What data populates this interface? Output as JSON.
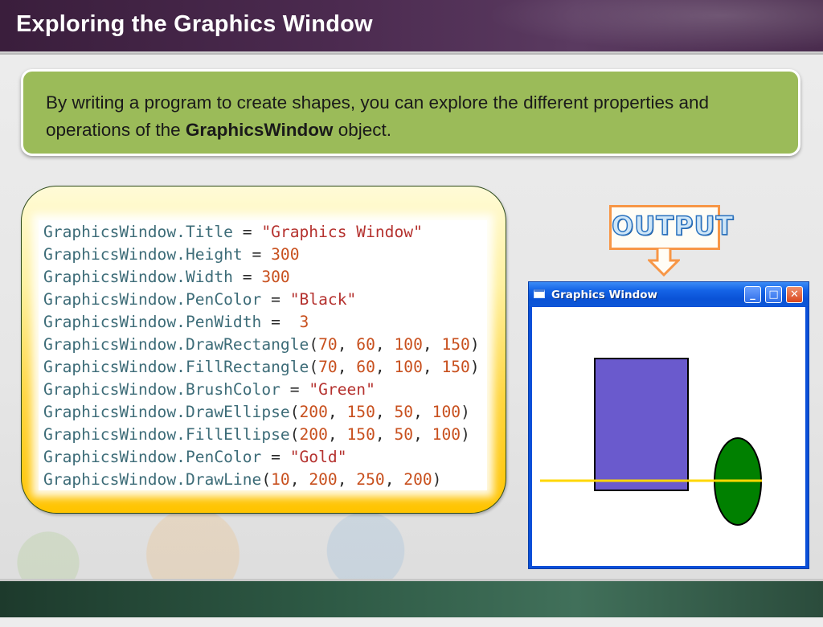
{
  "slide": {
    "title": "Exploring the Graphics Window",
    "intro": {
      "text_before": "By writing a program to create shapes, you can explore the different properties and operations of the ",
      "emphasis": "GraphicsWindow",
      "text_after": " object."
    }
  },
  "code": {
    "lines": [
      [
        {
          "t": "GraphicsWindow.Title ",
          "k": "id"
        },
        {
          "t": "= ",
          "k": "pun"
        },
        {
          "t": "\"Graphics Window\"",
          "k": "str"
        }
      ],
      [
        {
          "t": "GraphicsWindow.Height ",
          "k": "id"
        },
        {
          "t": "= ",
          "k": "pun"
        },
        {
          "t": "300",
          "k": "num"
        }
      ],
      [
        {
          "t": "GraphicsWindow.Width ",
          "k": "id"
        },
        {
          "t": "= ",
          "k": "pun"
        },
        {
          "t": "300",
          "k": "num"
        }
      ],
      [
        {
          "t": "GraphicsWindow.PenColor ",
          "k": "id"
        },
        {
          "t": "= ",
          "k": "pun"
        },
        {
          "t": "\"Black\"",
          "k": "str"
        }
      ],
      [
        {
          "t": "GraphicsWindow.PenWidth ",
          "k": "id"
        },
        {
          "t": "=  ",
          "k": "pun"
        },
        {
          "t": "3",
          "k": "num"
        }
      ],
      [
        {
          "t": "GraphicsWindow.DrawRectangle",
          "k": "id"
        },
        {
          "t": "(",
          "k": "pun"
        },
        {
          "t": "70",
          "k": "num"
        },
        {
          "t": ", ",
          "k": "pun"
        },
        {
          "t": "60",
          "k": "num"
        },
        {
          "t": ", ",
          "k": "pun"
        },
        {
          "t": "100",
          "k": "num"
        },
        {
          "t": ", ",
          "k": "pun"
        },
        {
          "t": "150",
          "k": "num"
        },
        {
          "t": ")",
          "k": "pun"
        }
      ],
      [
        {
          "t": "GraphicsWindow.FillRectangle",
          "k": "id"
        },
        {
          "t": "(",
          "k": "pun"
        },
        {
          "t": "70",
          "k": "num"
        },
        {
          "t": ", ",
          "k": "pun"
        },
        {
          "t": "60",
          "k": "num"
        },
        {
          "t": ", ",
          "k": "pun"
        },
        {
          "t": "100",
          "k": "num"
        },
        {
          "t": ", ",
          "k": "pun"
        },
        {
          "t": "150",
          "k": "num"
        },
        {
          "t": ")",
          "k": "pun"
        }
      ],
      [
        {
          "t": "GraphicsWindow.BrushColor ",
          "k": "id"
        },
        {
          "t": "= ",
          "k": "pun"
        },
        {
          "t": "\"Green\"",
          "k": "str"
        }
      ],
      [
        {
          "t": "GraphicsWindow.DrawEllipse",
          "k": "id"
        },
        {
          "t": "(",
          "k": "pun"
        },
        {
          "t": "200",
          "k": "num"
        },
        {
          "t": ", ",
          "k": "pun"
        },
        {
          "t": "150",
          "k": "num"
        },
        {
          "t": ", ",
          "k": "pun"
        },
        {
          "t": "50",
          "k": "num"
        },
        {
          "t": ", ",
          "k": "pun"
        },
        {
          "t": "100",
          "k": "num"
        },
        {
          "t": ")",
          "k": "pun"
        }
      ],
      [
        {
          "t": "GraphicsWindow.FillEllipse",
          "k": "id"
        },
        {
          "t": "(",
          "k": "pun"
        },
        {
          "t": "200",
          "k": "num"
        },
        {
          "t": ", ",
          "k": "pun"
        },
        {
          "t": "150",
          "k": "num"
        },
        {
          "t": ", ",
          "k": "pun"
        },
        {
          "t": "50",
          "k": "num"
        },
        {
          "t": ", ",
          "k": "pun"
        },
        {
          "t": "100",
          "k": "num"
        },
        {
          "t": ")",
          "k": "pun"
        }
      ],
      [
        {
          "t": "GraphicsWindow.PenColor ",
          "k": "id"
        },
        {
          "t": "= ",
          "k": "pun"
        },
        {
          "t": "\"Gold\"",
          "k": "str"
        }
      ],
      [
        {
          "t": "GraphicsWindow.DrawLine",
          "k": "id"
        },
        {
          "t": "(",
          "k": "pun"
        },
        {
          "t": "10",
          "k": "num"
        },
        {
          "t": ", ",
          "k": "pun"
        },
        {
          "t": "200",
          "k": "num"
        },
        {
          "t": ", ",
          "k": "pun"
        },
        {
          "t": "250",
          "k": "num"
        },
        {
          "t": ", ",
          "k": "pun"
        },
        {
          "t": "200",
          "k": "num"
        },
        {
          "t": ")",
          "k": "pun"
        }
      ]
    ]
  },
  "output": {
    "label": "OUTPUT"
  },
  "graphics_window": {
    "title": "Graphics Window",
    "buttons": {
      "minimize": "_",
      "maximize": "□",
      "close": "✕"
    },
    "shapes": {
      "rectangle": {
        "fill": "#6a5acd",
        "stroke": "#000000"
      },
      "ellipse": {
        "fill": "#008000",
        "stroke": "#000000"
      },
      "line": {
        "stroke": "#ffd700"
      }
    }
  },
  "colors": {
    "title_bar": "#4b2a4f",
    "intro_box": "#9bbb59",
    "code_panel": "#ffc400",
    "output_border": "#f79646",
    "window_frame": "#0a52d6",
    "footer": "#2e5a45"
  }
}
